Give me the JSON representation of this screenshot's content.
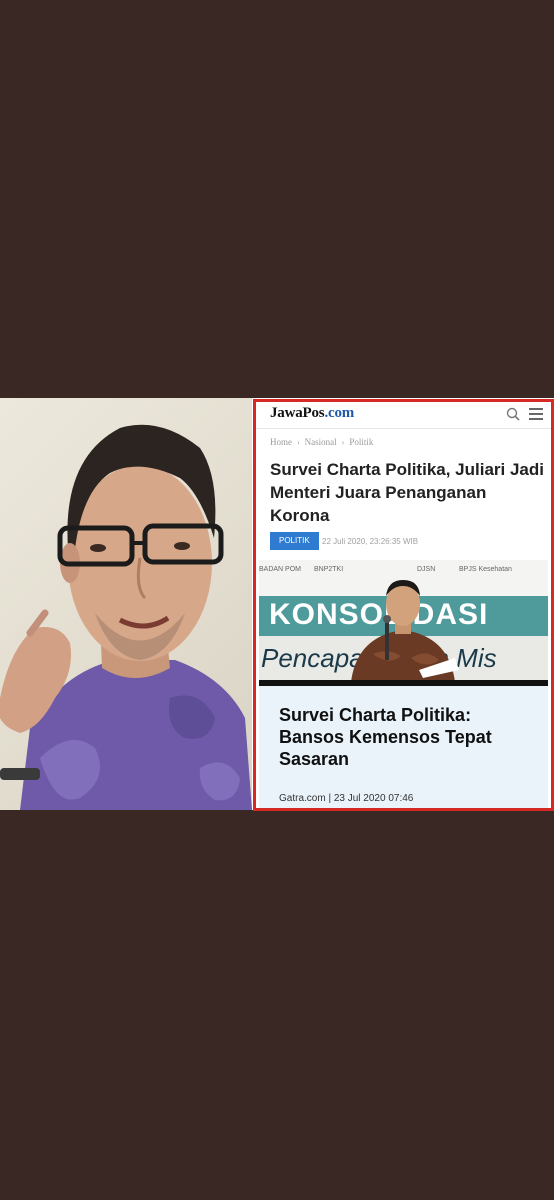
{
  "jawapos": {
    "logo_main": "JawaPos",
    "logo_suffix": ".com",
    "breadcrumb": [
      "Home",
      "Nasional",
      "Politik"
    ],
    "headline": "Survei Charta Politika, Juliari Jadi Menteri Juara Penanganan Korona",
    "tag": "POLITIK",
    "date": "22 Juli 2020, 23:26:35 WIB"
  },
  "news_photo": {
    "logos": [
      "BADAN POM",
      "BNP2TKI",
      "DJSN",
      "BPJS Kesehatan"
    ],
    "banner_text": "KONSOLIDASI",
    "banner_sub": "Pencapaian dan Mis"
  },
  "gatra": {
    "headline": "Survei Charta Politika: Bansos Kemensos Tepat Sasaran",
    "meta": "Gatra.com | 23 Jul 2020 07:46"
  },
  "colors": {
    "background": "#3a2825",
    "frame_red": "#d42a23",
    "tag_blue": "#2f7bd1",
    "gatra_bg": "#eaf3fa"
  }
}
